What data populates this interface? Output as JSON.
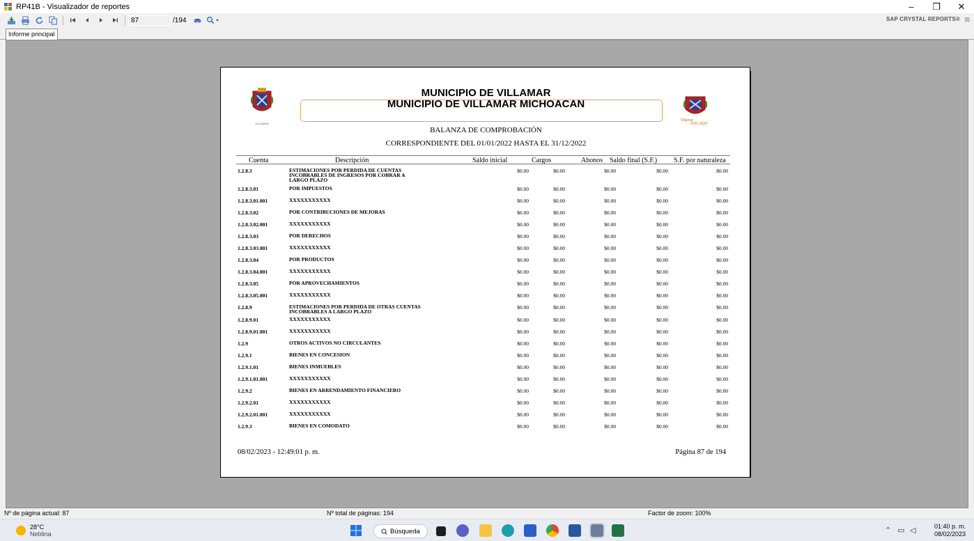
{
  "window": {
    "title": "RP41B - Visualizador de reportes",
    "min": "–",
    "max": "❐",
    "close": "✕"
  },
  "toolbar": {
    "current_page": "87",
    "total_pages": "/194",
    "brand": "SAP CRYSTAL REPORTS®",
    "brand_close": "⊠"
  },
  "tabs": {
    "main": "Informe principal"
  },
  "report": {
    "title1": "MUNICIPIO DE VILLAMAR",
    "title2": "MUNICIPIO DE VILLAMAR MICHOACAN",
    "subtitle1": "BALANZA DE COMPROBACIÓN",
    "subtitle2": "CORRESPONDIENTE DEL 01/01/2022 HASTA EL 31/12/2022",
    "logo_left_caption": "VILLAMAR",
    "logo_right_caption1": "Villamar",
    "logo_right_caption2": "2021-2024",
    "headers": {
      "cuenta": "Cuenta",
      "descripcion": "Descripción",
      "saldo_inicial": "Saldo inicial",
      "cargos": "Cargos",
      "abonos": "Abonos",
      "saldo_final": "Saldo final (S.F.)",
      "sf_naturaleza": "S.F. por naturaleza"
    },
    "rows": [
      {
        "cuenta": "1.2.8.3",
        "desc": "ESTIMACIONES POR PERDIDA DE CUENTAS INCOBRABLES DE INGRESOS POR COBRAR A LARGO PLAZO",
        "si": "$0.00",
        "c": "$0.00",
        "a": "$0.00",
        "sf": "$0.00",
        "sfn": "$0.00"
      },
      {
        "cuenta": "1.2.8.3.01",
        "desc": "POR IMPUESTOS",
        "si": "$0.00",
        "c": "$0.00",
        "a": "$0.00",
        "sf": "$0.00",
        "sfn": "$0.00"
      },
      {
        "cuenta": "1.2.8.3.01.001",
        "desc": "XXXXXXXXXXX",
        "si": "$0.00",
        "c": "$0.00",
        "a": "$0.00",
        "sf": "$0.00",
        "sfn": "$0.00"
      },
      {
        "cuenta": "1.2.8.3.02",
        "desc": "POR CONTRIBUCIONES DE MEJORAS",
        "si": "$0.00",
        "c": "$0.00",
        "a": "$0.00",
        "sf": "$0.00",
        "sfn": "$0.00"
      },
      {
        "cuenta": "1.2.8.3.02.001",
        "desc": "XXXXXXXXXXX",
        "si": "$0.00",
        "c": "$0.00",
        "a": "$0.00",
        "sf": "$0.00",
        "sfn": "$0.00"
      },
      {
        "cuenta": "1.2.8.3.03",
        "desc": "POR DERECHOS",
        "si": "$0.00",
        "c": "$0.00",
        "a": "$0.00",
        "sf": "$0.00",
        "sfn": "$0.00"
      },
      {
        "cuenta": "1.2.8.3.03.001",
        "desc": "XXXXXXXXXXX",
        "si": "$0.00",
        "c": "$0.00",
        "a": "$0.00",
        "sf": "$0.00",
        "sfn": "$0.00"
      },
      {
        "cuenta": "1.2.8.3.04",
        "desc": "POR PRODUCTOS",
        "si": "$0.00",
        "c": "$0.00",
        "a": "$0.00",
        "sf": "$0.00",
        "sfn": "$0.00"
      },
      {
        "cuenta": "1.2.8.3.04.001",
        "desc": "XXXXXXXXXXX",
        "si": "$0.00",
        "c": "$0.00",
        "a": "$0.00",
        "sf": "$0.00",
        "sfn": "$0.00"
      },
      {
        "cuenta": "1.2.8.3.05",
        "desc": "POR APROVECHAMIENTOS",
        "si": "$0.00",
        "c": "$0.00",
        "a": "$0.00",
        "sf": "$0.00",
        "sfn": "$0.00"
      },
      {
        "cuenta": "1.2.8.3.05.001",
        "desc": "XXXXXXXXXXX",
        "si": "$0.00",
        "c": "$0.00",
        "a": "$0.00",
        "sf": "$0.00",
        "sfn": "$0.00"
      },
      {
        "cuenta": "1.2.8.9",
        "desc": "ESTIMACIONES POR PERDIDA DE OTRAS CUENTAS INCOBRABLES A LARGO PLAZO",
        "si": "$0.00",
        "c": "$0.00",
        "a": "$0.00",
        "sf": "$0.00",
        "sfn": "$0.00"
      },
      {
        "cuenta": "1.2.8.9.01",
        "desc": "XXXXXXXXXXX",
        "si": "$0.00",
        "c": "$0.00",
        "a": "$0.00",
        "sf": "$0.00",
        "sfn": "$0.00"
      },
      {
        "cuenta": "1.2.8.9.01.001",
        "desc": "XXXXXXXXXXX",
        "si": "$0.00",
        "c": "$0.00",
        "a": "$0.00",
        "sf": "$0.00",
        "sfn": "$0.00"
      },
      {
        "cuenta": "1.2.9",
        "desc": "OTROS ACTIVOS NO CIRCULANTES",
        "si": "$0.00",
        "c": "$0.00",
        "a": "$0.00",
        "sf": "$0.00",
        "sfn": "$0.00"
      },
      {
        "cuenta": "1.2.9.1",
        "desc": "BIENES EN CONCESION",
        "si": "$0.00",
        "c": "$0.00",
        "a": "$0.00",
        "sf": "$0.00",
        "sfn": "$0.00"
      },
      {
        "cuenta": "1.2.9.1.01",
        "desc": "BIENES INMUEBLES",
        "si": "$0.00",
        "c": "$0.00",
        "a": "$0.00",
        "sf": "$0.00",
        "sfn": "$0.00"
      },
      {
        "cuenta": "1.2.9.1.01.001",
        "desc": "XXXXXXXXXXX",
        "si": "$0.00",
        "c": "$0.00",
        "a": "$0.00",
        "sf": "$0.00",
        "sfn": "$0.00"
      },
      {
        "cuenta": "1.2.9.2",
        "desc": "BIENES EN ARRENDAMIENTO FINANCIERO",
        "si": "$0.00",
        "c": "$0.00",
        "a": "$0.00",
        "sf": "$0.00",
        "sfn": "$0.00"
      },
      {
        "cuenta": "1.2.9.2.01",
        "desc": "XXXXXXXXXXX",
        "si": "$0.00",
        "c": "$0.00",
        "a": "$0.00",
        "sf": "$0.00",
        "sfn": "$0.00"
      },
      {
        "cuenta": "1.2.9.2.01.001",
        "desc": "XXXXXXXXXXX",
        "si": "$0.00",
        "c": "$0.00",
        "a": "$0.00",
        "sf": "$0.00",
        "sfn": "$0.00"
      },
      {
        "cuenta": "1.2.9.3",
        "desc": "BIENES EN COMODATO",
        "si": "$0.00",
        "c": "$0.00",
        "a": "$0.00",
        "sf": "$0.00",
        "sfn": "$0.00"
      }
    ],
    "footer_left": "08/02/2023 - 12:49:01 p. m.",
    "footer_right": "Página 87 de 194"
  },
  "statusbar": {
    "current": "Nº de página actual: 87",
    "total": "Nº total de páginas: 194",
    "zoom": "Factor de zoom: 100%"
  },
  "taskbar": {
    "weather_temp": "28°C",
    "weather_desc": "Neblina",
    "search_label": "Búsqueda",
    "time": "01:40 p. m.",
    "date": "08/02/2023"
  },
  "colors": {
    "report_bg": "#a8a8a8",
    "accent": "#e0a060",
    "taskbar": "#e8ecf2"
  }
}
